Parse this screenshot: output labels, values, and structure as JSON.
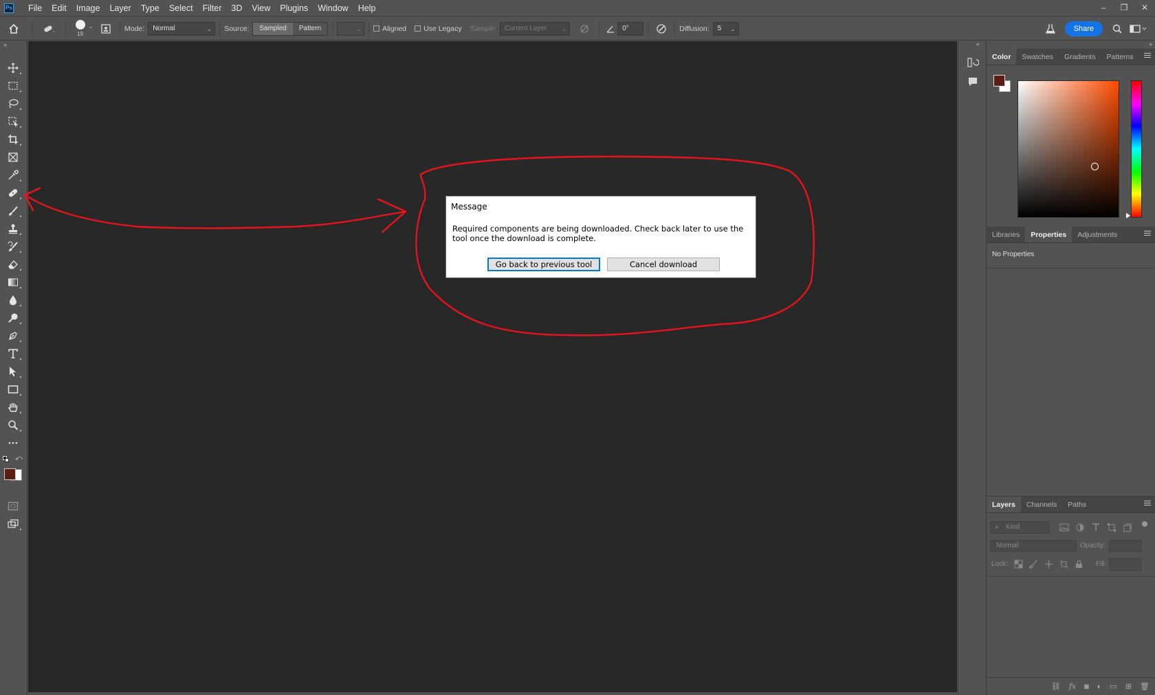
{
  "app": {
    "logo": "Ps"
  },
  "menu": [
    "File",
    "Edit",
    "Image",
    "Layer",
    "Type",
    "Select",
    "Filter",
    "3D",
    "View",
    "Plugins",
    "Window",
    "Help"
  ],
  "window_controls": {
    "minimize": "–",
    "restore": "❐",
    "close": "✕"
  },
  "options": {
    "brush_size": "19",
    "mode_label": "Mode:",
    "mode_value": "Normal",
    "source_label": "Source:",
    "source_sampled": "Sampled",
    "source_pattern": "Pattern",
    "aligned_label": "Aligned",
    "use_legacy_label": "Use Legacy",
    "sample_label": "Sample:",
    "sample_value": "Current Layer",
    "angle_value": "0°",
    "diffusion_label": "Diffusion:",
    "diffusion_value": "5",
    "share_label": "Share"
  },
  "dialog": {
    "title": "Message",
    "message": "Required components are being downloaded. Check back later to use the tool once the download is complete.",
    "btn_back": "Go back to previous tool",
    "btn_cancel": "Cancel download"
  },
  "color_panel": {
    "tabs": [
      "Color",
      "Swatches",
      "Gradients",
      "Patterns"
    ],
    "foreground": "#5a1e14",
    "background": "#ffffff"
  },
  "properties_panel": {
    "tabs": [
      "Libraries",
      "Properties",
      "Adjustments"
    ],
    "content": "No Properties"
  },
  "layers_panel": {
    "tabs": [
      "Layers",
      "Channels",
      "Paths"
    ],
    "filter_placeholder": "Kind",
    "blend_mode": "Normal",
    "opacity_label": "Opacity:",
    "lock_label": "Lock:",
    "fill_label": "Fill:"
  },
  "colors": {
    "ui_bg": "#535353",
    "canvas": "#282828",
    "accent": "#1473e6",
    "annotation": "#e8131c"
  }
}
